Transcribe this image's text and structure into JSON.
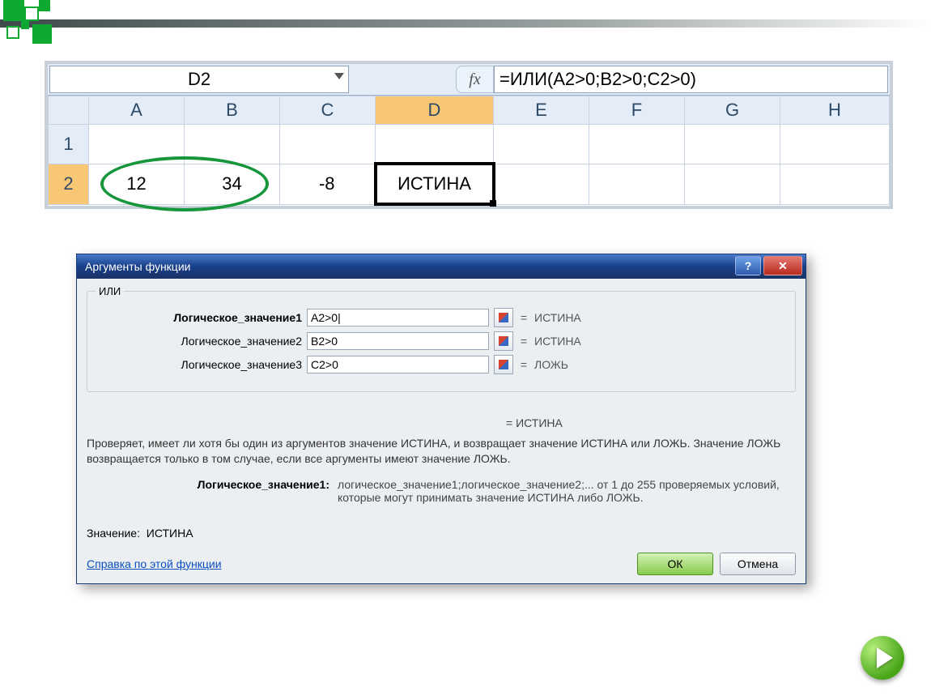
{
  "slide": {
    "name_box": "D2",
    "formula": "=ИЛИ(A2>0;B2>0;C2>0)",
    "fx_label": "fx",
    "columns": [
      "A",
      "B",
      "C",
      "D",
      "E",
      "F",
      "G",
      "H"
    ],
    "rows": [
      "1",
      "2"
    ],
    "cells": {
      "A2": "12",
      "B2": "34",
      "C2": "-8",
      "D2": "ИСТИНА"
    }
  },
  "dialog": {
    "title": "Аргументы функции",
    "function_name": "ИЛИ",
    "args": [
      {
        "label": "Логическое_значение1",
        "bold": true,
        "value": "A2>0|",
        "result": "ИСТИНА"
      },
      {
        "label": "Логическое_значение2",
        "bold": false,
        "value": "B2>0",
        "result": "ИСТИНА"
      },
      {
        "label": "Логическое_значение3",
        "bold": false,
        "value": "C2>0",
        "result": "ЛОЖЬ"
      }
    ],
    "total_result_prefix": "=  ",
    "total_result": "ИСТИНА",
    "description": "Проверяет, имеет ли хотя бы один из аргументов значение ИСТИНА, и возвращает значение ИСТИНА или ЛОЖЬ. Значение ЛОЖЬ возвращается только в том случае, если все аргументы имеют значение ЛОЖЬ.",
    "arg_help_label": "Логическое_значение1:",
    "arg_help_text": "логическое_значение1;логическое_значение2;... от 1 до 255 проверяемых условий, которые могут принимать значение ИСТИНА либо ЛОЖЬ.",
    "value_label": "Значение:",
    "value": "ИСТИНА",
    "help_link": "Справка по этой функции",
    "ok": "ОК",
    "cancel": "Отмена",
    "help_glyph": "?",
    "close_glyph": "✕"
  }
}
